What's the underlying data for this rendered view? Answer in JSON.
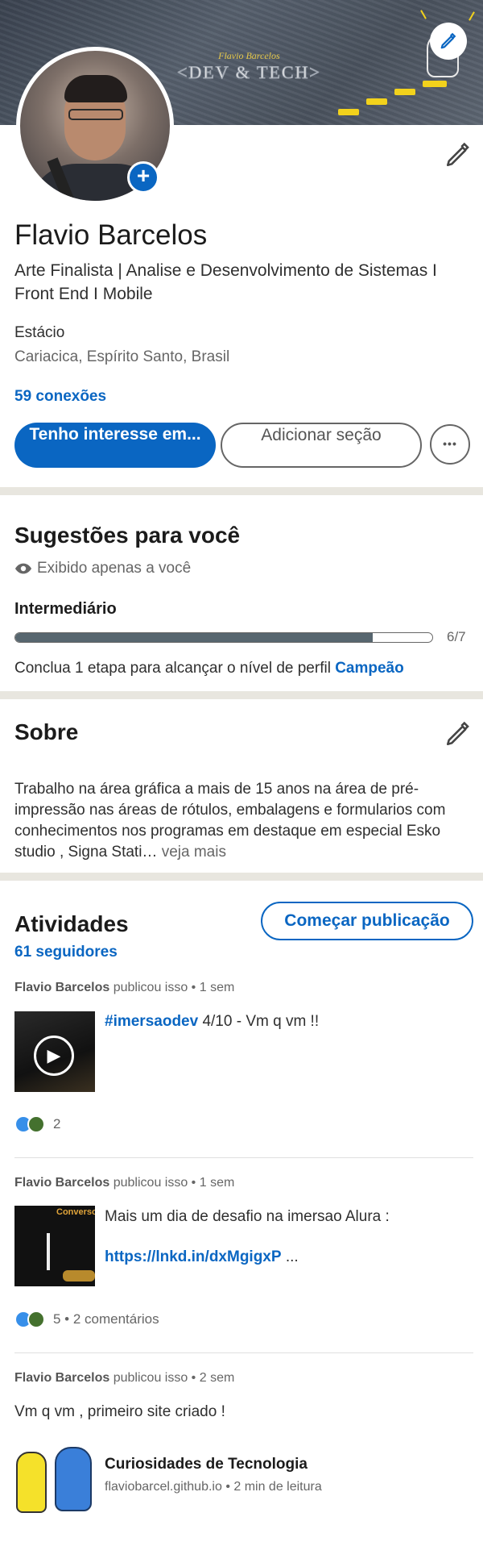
{
  "banner": {
    "sub_text": "Flavio Barcelos",
    "main_text": "<DEV & TECH>"
  },
  "profile": {
    "name": "Flavio Barcelos",
    "headline": "Arte Finalista | Analise e Desenvolvimento de Sistemas I Front End I Mobile",
    "education": "Estácio",
    "location": "Cariacica, Espírito Santo, Brasil",
    "connections": "59 conexões",
    "add_photo": "+"
  },
  "actions": {
    "open_to": "Tenho interesse em...",
    "add_section": "Adicionar seção",
    "more": "•••"
  },
  "suggestions": {
    "title": "Sugestões para você",
    "visibility": "Exibido apenas a você",
    "level": "Intermediário",
    "progress": 0.857,
    "progress_label": "6/7",
    "next_step_prefix": "Conclua 1 etapa para alcançar o nível de perfil",
    "next_step_level": "Campeão"
  },
  "about": {
    "title": "Sobre",
    "text": "Trabalho na área gráfica a mais de 15 anos na  área de pré-impressão nas áreas de rótulos, embalagens e formularios com conhecimentos nos programas em destaque em especial Esko studio , Signa Stati…",
    "see_more": "veja mais"
  },
  "activity": {
    "title": "Atividades",
    "followers": "61 seguidores",
    "start_post": "Começar publicação",
    "posts": [
      {
        "author": "Flavio Barcelos",
        "action": "publicou isso • 1 sem",
        "hashtag": "#imersaodev",
        "text": " 4/10  - Vm q vm !!",
        "reactions": "2"
      },
      {
        "author": "Flavio Barcelos",
        "action": "publicou isso • 1 sem",
        "text": "Mais um dia de desafio na imersao Alura :",
        "link": "https://lnkd.in/dxMgigxP",
        "link_suffix": " ...",
        "reactions": "5 • 2 comentários",
        "thumb_label": "Conversor"
      },
      {
        "author": "Flavio Barcelos",
        "action": "publicou isso • 2 sem",
        "text": "Vm q vm , primeiro site criado !",
        "card_title": "Curiosidades de Tecnologia",
        "card_sub": "flaviobarcel.github.io • 2 min de leitura"
      }
    ]
  },
  "colors": {
    "accent": "#0a66c2",
    "separator": "#e8e6df",
    "progress": "#57666f"
  },
  "icons": [
    "pencil-icon",
    "plus-icon",
    "eye-icon",
    "play-icon",
    "ellipsis-icon",
    "reaction-icons"
  ]
}
